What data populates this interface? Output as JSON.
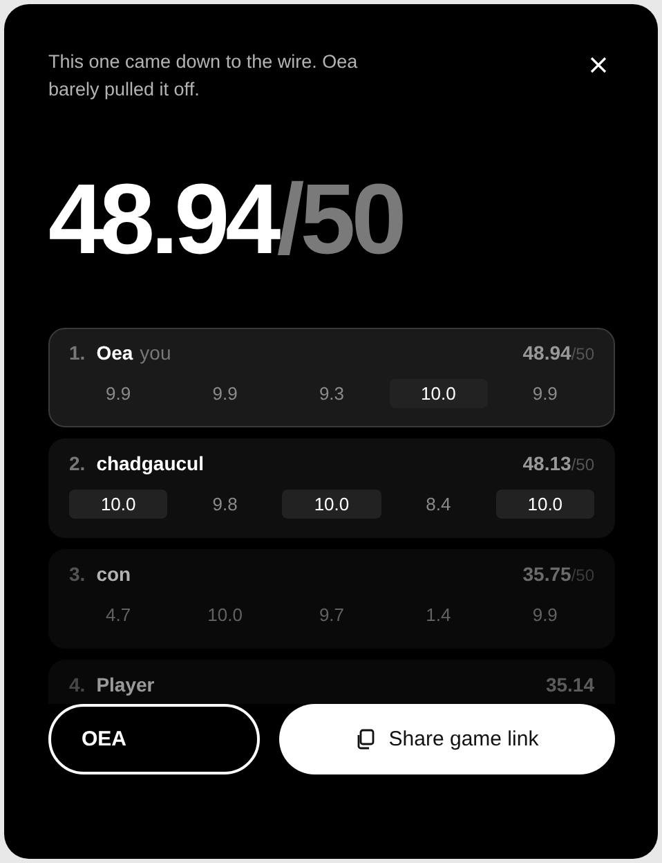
{
  "message": "This one came down to the wire. Oea barely pulled it off.",
  "score": {
    "value": "48.94",
    "total": "/50"
  },
  "players": [
    {
      "rank": "1.",
      "name": "Oea",
      "tag": "you",
      "selected": true,
      "score": "48.94",
      "total": "/50",
      "rounds": [
        {
          "value": "9.9",
          "best": false
        },
        {
          "value": "9.9",
          "best": false
        },
        {
          "value": "9.3",
          "best": false
        },
        {
          "value": "10.0",
          "best": true
        },
        {
          "value": "9.9",
          "best": false
        }
      ]
    },
    {
      "rank": "2.",
      "name": "chadgaucul",
      "selected": false,
      "score": "48.13",
      "total": "/50",
      "rounds": [
        {
          "value": "10.0",
          "best": true
        },
        {
          "value": "9.8",
          "best": false
        },
        {
          "value": "10.0",
          "best": true
        },
        {
          "value": "8.4",
          "best": false
        },
        {
          "value": "10.0",
          "best": true
        }
      ]
    },
    {
      "rank": "3.",
      "name": "con",
      "selected": false,
      "score": "35.75",
      "total": "/50",
      "rounds": [
        {
          "value": "4.7",
          "best": false
        },
        {
          "value": "10.0",
          "best": false
        },
        {
          "value": "9.7",
          "best": false
        },
        {
          "value": "1.4",
          "best": false
        },
        {
          "value": "9.9",
          "best": false
        }
      ]
    },
    {
      "rank": "4.",
      "name": "Player",
      "selected": false,
      "score": "35.14"
    }
  ],
  "buttons": [
    {
      "kind": "outline",
      "label": "OEA"
    },
    {
      "kind": "share",
      "label": "Share game link"
    }
  ]
}
